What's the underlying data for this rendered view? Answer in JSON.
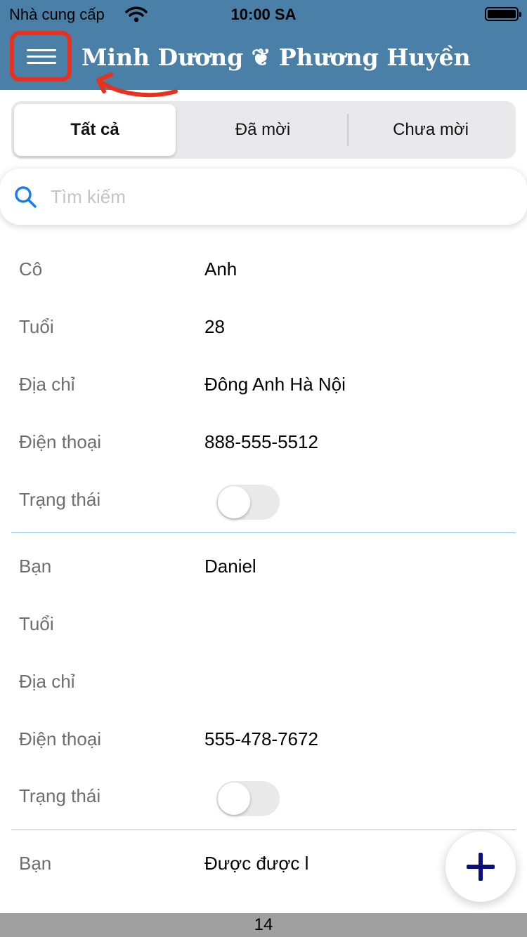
{
  "status": {
    "carrier": "Nhà cung cấp",
    "time": "10:00 SA"
  },
  "header": {
    "title": "Minh Dương ❦ Phương Huyền",
    "menu_icon": "hamburger-icon"
  },
  "tabs": [
    {
      "label": "Tất cả",
      "selected": true
    },
    {
      "label": "Đã mời",
      "selected": false
    },
    {
      "label": "Chưa mời",
      "selected": false
    }
  ],
  "search": {
    "placeholder": "Tìm kiếm",
    "value": ""
  },
  "guests": [
    {
      "title_label": "Cô",
      "name": "Anh",
      "age_label": "Tuổi",
      "age": "28",
      "address_label": "Địa chỉ",
      "address": "Đông Anh Hà Nội",
      "phone_label": "Điện thoại",
      "phone": "888-555-5512",
      "status_label": "Trạng thái",
      "invited": false
    },
    {
      "title_label": "Bạn",
      "name": "Daniel",
      "age_label": "Tuổi",
      "age": "",
      "address_label": "Địa chỉ",
      "address": "",
      "phone_label": "Điện thoại",
      "phone": "555-478-7672",
      "status_label": "Trạng thái",
      "invited": false
    },
    {
      "title_label": "Bạn",
      "name": "Được được l"
    }
  ],
  "fab": {
    "icon": "plus-icon"
  },
  "footer": {
    "page_number": "14"
  },
  "colors": {
    "header_bg": "#4a7fa7",
    "accent": "#1a7ee8",
    "fab_plus": "#0c0e7e",
    "separator": "#8ec7e0",
    "annotation": "#e8301c"
  }
}
